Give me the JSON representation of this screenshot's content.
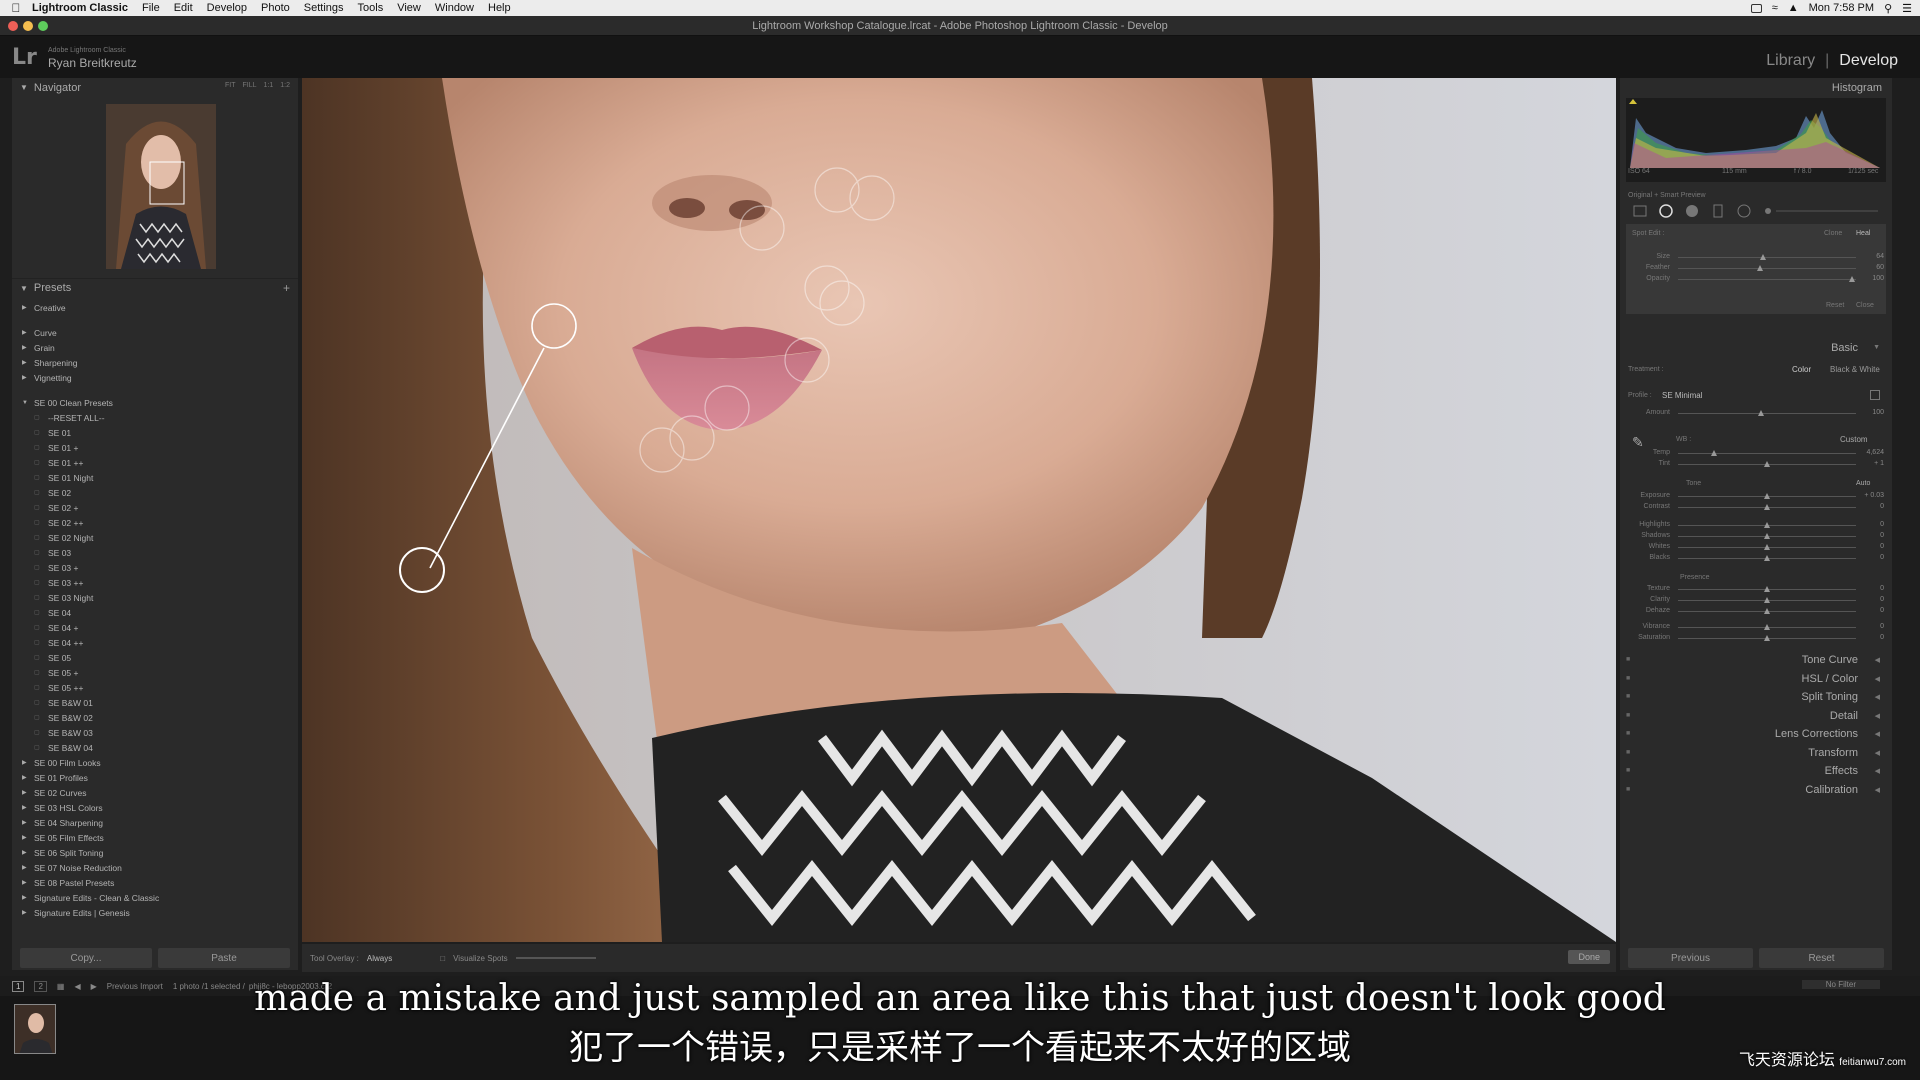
{
  "menubar": {
    "app": "Lightroom Classic",
    "items": [
      "File",
      "Edit",
      "Develop",
      "Photo",
      "Settings",
      "Tools",
      "View",
      "Window",
      "Help"
    ],
    "clock": "Mon 7:58 PM"
  },
  "window": {
    "title": "Lightroom Workshop Catalogue.lrcat - Adobe Photoshop Lightroom Classic - Develop"
  },
  "identity": {
    "product": "Adobe Lightroom Classic",
    "user": "Ryan Breitkreutz"
  },
  "modules": {
    "library": "Library",
    "separator": "|",
    "develop": "Develop"
  },
  "navigator": {
    "title": "Navigator",
    "zoom": [
      "FIT",
      "FILL",
      "1:1",
      "1:2"
    ]
  },
  "presets": {
    "title": "Presets",
    "add": "+",
    "groups_top": [
      "Creative",
      "Curve",
      "Grain",
      "Sharpening",
      "Vignetting"
    ],
    "open_group": "SE 00 Clean Presets",
    "open_items": [
      "--RESET ALL--",
      "SE 01",
      "SE 01 +",
      "SE 01 ++",
      "SE 01 Night",
      "SE 02",
      "SE 02 +",
      "SE 02 ++",
      "SE 02 Night",
      "SE 03",
      "SE 03 +",
      "SE 03 ++",
      "SE 03 Night",
      "SE 04",
      "SE 04 +",
      "SE 04 ++",
      "SE 05",
      "SE 05 +",
      "SE 05 ++",
      "SE B&W 01",
      "SE B&W 02",
      "SE B&W 03",
      "SE B&W 04"
    ],
    "groups_bottom": [
      "SE 00 Film Looks",
      "SE 01 Profiles",
      "SE 02 Curves",
      "SE 03 HSL Colors",
      "SE 04 Sharpening",
      "SE 05 Film Effects",
      "SE 06 Split Toning",
      "SE 07 Noise Reduction",
      "SE 08 Pastel Presets",
      "Signature Edits - Clean & Classic",
      "Signature Edits | Genesis"
    ]
  },
  "left_buttons": {
    "copy": "Copy...",
    "paste": "Paste"
  },
  "toolbar": {
    "overlay_label": "Tool Overlay :",
    "overlay_value": "Always",
    "visualize": "Visualize Spots",
    "done": "Done"
  },
  "histogram": {
    "title": "Histogram",
    "iso": "ISO 64",
    "focal": "115 mm",
    "aperture": "f / 8.0",
    "shutter": "1/125 sec",
    "preview": "Original + Smart Preview"
  },
  "spot": {
    "title": "Spot Edit :",
    "clone": "Clone",
    "heal": "Heal",
    "rows": [
      {
        "label": "Size",
        "value": "64",
        "pos": 0.48
      },
      {
        "label": "Feather",
        "value": "60",
        "pos": 0.46
      },
      {
        "label": "Opacity",
        "value": "100",
        "pos": 0.98
      }
    ],
    "reset": "Reset",
    "close": "Close"
  },
  "basic": {
    "title": "Basic",
    "treatment_label": "Treatment :",
    "color": "Color",
    "bw": "Black & White",
    "profile_label": "Profile :",
    "profile": "SE Minimal",
    "amount_label": "Amount",
    "amount": "100",
    "wb_label": "WB :",
    "wb": "Custom",
    "temp": {
      "label": "Temp",
      "value": "4,624",
      "pos": 0.2
    },
    "tint": {
      "label": "Tint",
      "value": "+ 1",
      "pos": 0.5
    },
    "tone_label": "Tone",
    "auto": "Auto",
    "tone": [
      {
        "label": "Exposure",
        "value": "+ 0.03",
        "pos": 0.5
      },
      {
        "label": "Contrast",
        "value": "0",
        "pos": 0.5
      },
      {
        "label": "Highlights",
        "value": "0",
        "pos": 0.5
      },
      {
        "label": "Shadows",
        "value": "0",
        "pos": 0.5
      },
      {
        "label": "Whites",
        "value": "0",
        "pos": 0.5
      },
      {
        "label": "Blacks",
        "value": "0",
        "pos": 0.5
      }
    ],
    "presence_label": "Presence",
    "presence": [
      {
        "label": "Texture",
        "value": "0",
        "pos": 0.5
      },
      {
        "label": "Clarity",
        "value": "0",
        "pos": 0.5
      },
      {
        "label": "Dehaze",
        "value": "0",
        "pos": 0.5
      },
      {
        "label": "Vibrance",
        "value": "0",
        "pos": 0.5
      },
      {
        "label": "Saturation",
        "value": "0",
        "pos": 0.5
      }
    ]
  },
  "sections": [
    "Tone Curve",
    "HSL / Color",
    "Split Toning",
    "Detail",
    "Lens Corrections",
    "Transform",
    "Effects",
    "Calibration"
  ],
  "right_buttons": {
    "previous": "Previous",
    "reset": "Reset"
  },
  "filmstrip": {
    "page1": "1",
    "page2": "2",
    "source": "Previous Import",
    "info": "1 photo /1 selected /",
    "file": "phjj8c - lebopp2003.cr2",
    "filter": "No Filter"
  },
  "subtitles": {
    "en": "made a mistake and just sampled an area like this that just doesn't look good",
    "zh": "犯了一个错误，只是采样了一个看起来不太好的区域"
  },
  "watermark": {
    "text": "飞天资源论坛",
    "url": "feitianwu7.com"
  }
}
